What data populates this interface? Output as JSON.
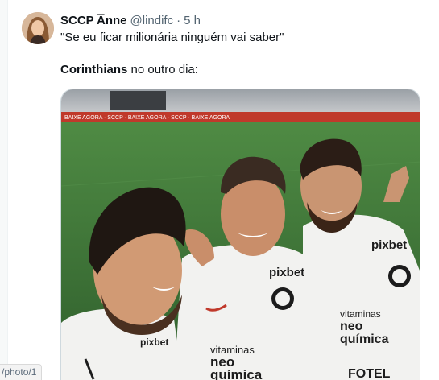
{
  "tweet": {
    "display_name": "SCCP A̅nne",
    "handle": "@lindifc",
    "separator": "·",
    "time": "5 h",
    "quote": "\"Se eu ficar milionária ninguém vai saber\"",
    "caption_bold": "Corinthians",
    "caption_rest": " no outro dia:"
  },
  "media": {
    "banner_text": "BAIXE AGORA · SCCP · BAIXE AGORA · SCCP · BAIXE AGORA",
    "shirt_left_sponsor": "pixbet",
    "shirt_mid_sponsor": "pixbet",
    "shirt_mid_brand_1": "vitaminas",
    "shirt_mid_brand_2": "neo",
    "shirt_mid_brand_3": "química",
    "shirt_right_sponsor": "pixbet",
    "shirt_right_brand_1": "vitaminas",
    "shirt_right_brand_2": "neo",
    "shirt_right_brand_3": "química",
    "shirt_right_bottom": "FOTEL"
  },
  "status_bar": {
    "url": "/photo/1"
  },
  "colors": {
    "text_primary": "#0f1419",
    "text_secondary": "#536471",
    "grass": "#3f7a3a",
    "shirt": "#f2f2f0"
  }
}
